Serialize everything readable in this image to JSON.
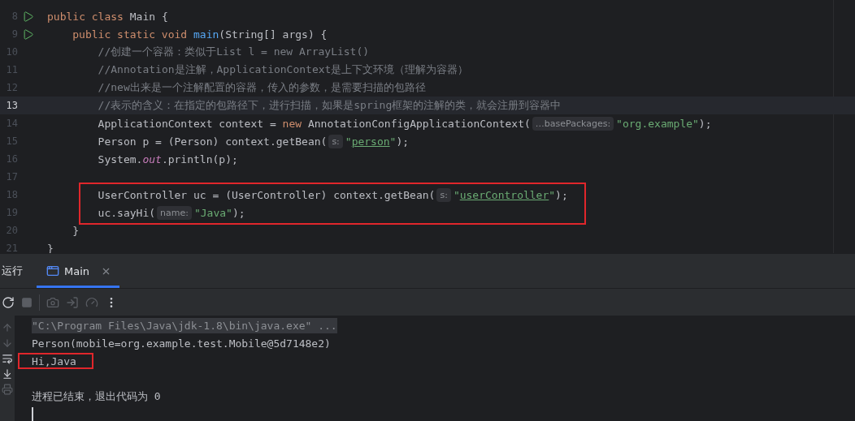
{
  "editor": {
    "lines": [
      {
        "number": "8",
        "runnable": true,
        "current": false,
        "boxed": false,
        "tokens": [
          {
            "kind": "kw",
            "text": "public class "
          },
          {
            "kind": "plain",
            "text": "Main {"
          }
        ]
      },
      {
        "number": "9",
        "runnable": true,
        "current": false,
        "boxed": false,
        "tokens": [
          {
            "kind": "kw",
            "text": "    public static void "
          },
          {
            "kind": "method",
            "text": "main"
          },
          {
            "kind": "plain",
            "text": "(String[] args) {"
          }
        ]
      },
      {
        "number": "10",
        "runnable": false,
        "current": false,
        "boxed": false,
        "tokens": [
          {
            "kind": "comment",
            "text": "        //创建一个容器：类似于List l = new ArrayList()"
          }
        ]
      },
      {
        "number": "11",
        "runnable": false,
        "current": false,
        "boxed": false,
        "tokens": [
          {
            "kind": "comment",
            "text": "        //Annotation是注解，ApplicationContext是上下文环境（理解为容器）"
          }
        ]
      },
      {
        "number": "12",
        "runnable": false,
        "current": false,
        "boxed": false,
        "tokens": [
          {
            "kind": "comment",
            "text": "        //new出来是一个注解配置的容器，传入的参数，是需要扫描的包路径"
          }
        ]
      },
      {
        "number": "13",
        "runnable": false,
        "current": true,
        "boxed": false,
        "tokens": [
          {
            "kind": "comment",
            "text": "        //表示的含义：在指定的包路径下，进行扫描，如果是spring框架的注解的类，就会注册到容器中"
          }
        ]
      },
      {
        "number": "14",
        "runnable": false,
        "current": false,
        "boxed": false,
        "tokens": [
          {
            "kind": "plain",
            "text": "        ApplicationContext context = "
          },
          {
            "kind": "kw",
            "text": "new "
          },
          {
            "kind": "plain",
            "text": "AnnotationConfigApplicationContext("
          },
          {
            "kind": "hint",
            "text": "…basePackages:"
          },
          {
            "kind": "str",
            "text": "\"org.example\""
          },
          {
            "kind": "plain",
            "text": ");"
          }
        ]
      },
      {
        "number": "15",
        "runnable": false,
        "current": false,
        "boxed": false,
        "tokens": [
          {
            "kind": "plain",
            "text": "        Person p = (Person) context.getBean("
          },
          {
            "kind": "hint",
            "text": "s:"
          },
          {
            "kind": "str",
            "text": "\""
          },
          {
            "kind": "link",
            "text": "person"
          },
          {
            "kind": "str",
            "text": "\""
          },
          {
            "kind": "plain",
            "text": ");"
          }
        ]
      },
      {
        "number": "16",
        "runnable": false,
        "current": false,
        "boxed": false,
        "tokens": [
          {
            "kind": "plain",
            "text": "        System."
          },
          {
            "kind": "field",
            "text": "out"
          },
          {
            "kind": "plain",
            "text": ".println(p);"
          }
        ]
      },
      {
        "number": "17",
        "runnable": false,
        "current": false,
        "boxed": false
      },
      {
        "number": "18",
        "runnable": false,
        "current": false,
        "boxed": true,
        "tokens": [
          {
            "kind": "plain",
            "text": "        UserController uc = (UserController) context.getBean("
          },
          {
            "kind": "hint",
            "text": "s:"
          },
          {
            "kind": "str",
            "text": "\""
          },
          {
            "kind": "link",
            "text": "userController"
          },
          {
            "kind": "str",
            "text": "\""
          },
          {
            "kind": "plain",
            "text": ");"
          }
        ]
      },
      {
        "number": "19",
        "runnable": false,
        "current": false,
        "boxed": true,
        "tokens": [
          {
            "kind": "plain",
            "text": "        uc.sayHi("
          },
          {
            "kind": "hint",
            "text": "name:"
          },
          {
            "kind": "str",
            "text": "\"Java\""
          },
          {
            "kind": "plain",
            "text": ");"
          }
        ]
      },
      {
        "number": "20",
        "runnable": false,
        "current": false,
        "boxed": false,
        "tokens": [
          {
            "kind": "plain",
            "text": "    }"
          }
        ]
      },
      {
        "number": "21",
        "runnable": false,
        "current": false,
        "boxed": false,
        "tokens": [
          {
            "kind": "plain",
            "text": "}"
          }
        ]
      }
    ]
  },
  "run_window": {
    "title": "运行",
    "tabs": [
      {
        "label": "Main",
        "selected": true
      }
    ],
    "output": [
      {
        "kind": "command",
        "boxed": false,
        "text": "\"C:\\Program Files\\Java\\jdk-1.8\\bin\\java.exe\" ..."
      },
      {
        "kind": "text",
        "boxed": false,
        "text": "Person(mobile=org.example.test.Mobile@5d7148e2)"
      },
      {
        "kind": "text",
        "boxed": true,
        "text": "Hi,Java"
      },
      {
        "kind": "blank",
        "boxed": false
      },
      {
        "kind": "text",
        "boxed": false,
        "text": "进程已结束，退出代码为 0"
      },
      {
        "kind": "cursor",
        "boxed": false
      }
    ]
  }
}
